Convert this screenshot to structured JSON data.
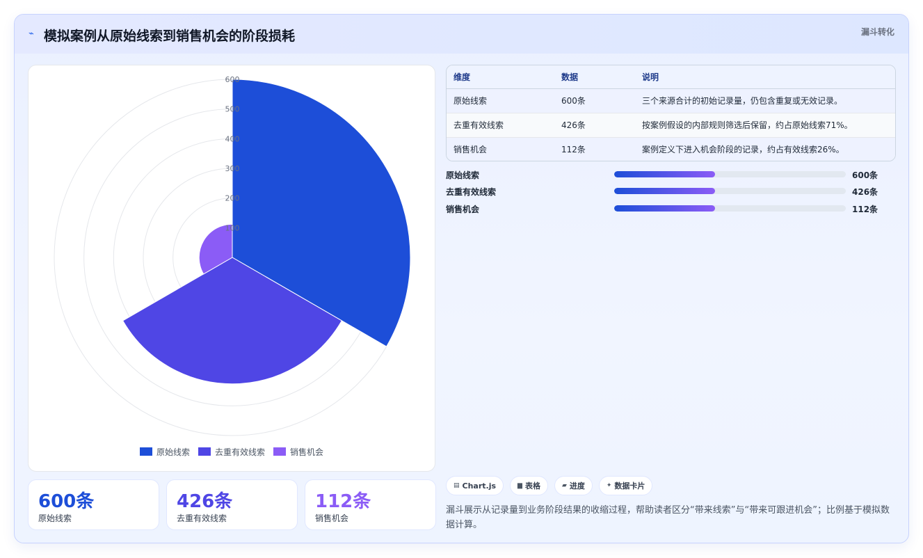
{
  "header": {
    "icon": "trend-icon",
    "title": "模拟案例从原始线索到销售机会的阶段损耗",
    "tag": "漏斗转化"
  },
  "colors": {
    "stage1": "#1d4ed8",
    "stage2": "#4f46e5",
    "stage3": "#8b5cf6",
    "accent_gradient": [
      "#1d4ed8",
      "#8b5cf6"
    ]
  },
  "chart_data": {
    "type": "polarArea",
    "categories": [
      "原始线索",
      "去重有效线索",
      "销售机会"
    ],
    "values": [
      600,
      426,
      112
    ],
    "r_ticks": [
      600,
      500,
      400,
      300,
      200,
      100
    ],
    "r_range": [
      0,
      600
    ],
    "grid": true,
    "legend_position": "bottom",
    "legend": [
      "原始线索",
      "去重有效线索",
      "销售机会"
    ]
  },
  "stats": [
    {
      "value": "600条",
      "label": "原始线索",
      "color": "#1d4ed8"
    },
    {
      "value": "426条",
      "label": "去重有效线索",
      "color": "#4f46e5"
    },
    {
      "value": "112条",
      "label": "销售机会",
      "color": "#8b5cf6"
    }
  ],
  "table": {
    "headers": [
      "维度",
      "数据",
      "说明"
    ],
    "rows": [
      [
        "原始线索",
        "600条",
        "三个来源合计的初始记录量，仍包含重复或无效记录。"
      ],
      [
        "去重有效线索",
        "426条",
        "按案例假设的内部规则筛选后保留，约占原始线索71%。"
      ],
      [
        "销售机会",
        "112条",
        "案例定义下进入机会阶段的记录，约占有效线索26%。"
      ]
    ]
  },
  "progress": [
    {
      "label": "原始线索",
      "value": "600条",
      "fill_percent": 43.5
    },
    {
      "label": "去重有效线索",
      "value": "426条",
      "fill_percent": 43.5
    },
    {
      "label": "销售机会",
      "value": "112条",
      "fill_percent": 43.5
    }
  ],
  "chips": [
    {
      "icon": "chart-icon",
      "glyph": "▤",
      "label": "Chart.js"
    },
    {
      "icon": "table-icon",
      "glyph": "▆",
      "label": "表格"
    },
    {
      "icon": "progress-icon",
      "glyph": "▰",
      "label": "进度"
    },
    {
      "icon": "sparkle-icon",
      "glyph": "✦",
      "label": "数据卡片"
    }
  ],
  "note": "漏斗展示从记录量到业务阶段结果的收缩过程，帮助读者区分“带来线索”与“带来可跟进机会”；比例基于模拟数据计算。"
}
